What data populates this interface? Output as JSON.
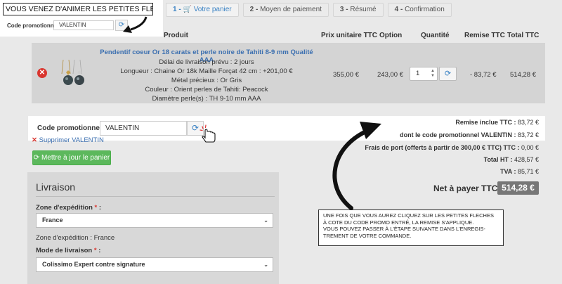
{
  "steps": [
    {
      "num": "1 - ",
      "label": "Votre panier",
      "icon": "cart-icon"
    },
    {
      "num": "2 - ",
      "label": "Moyen de paiement"
    },
    {
      "num": "3 - ",
      "label": "Résumé"
    },
    {
      "num": "4 - ",
      "label": "Confirmation"
    }
  ],
  "top_callout": {
    "note": "VOUS VENEZ D'ANIMER LES PETITES FLECHES",
    "promo_label": "Code promotionnel :",
    "promo_value": "VALENTIN"
  },
  "table": {
    "headers": {
      "product": "Produit",
      "unit_price": "Prix unitaire TTC",
      "option": "Option",
      "quantity": "Quantité",
      "discount": "Remise TTC",
      "total": "Total TTC"
    }
  },
  "product": {
    "title": "Pendentif coeur Or 18 carats et perle noire de Tahiti 8-9 mm Qualité AAA",
    "lines": [
      "Délai de livraison prévu : 2 jours",
      "Longueur : Chaine Or 18k Maille Forçat 42 cm : +201,00 €",
      "Métal précieux : Or Gris",
      "Couleur : Orient perles de Tahiti: Peacock",
      "Diamètre perle(s) : TH 9-10 mm AAA"
    ],
    "unit_price": "355,00 €",
    "option": "243,00 €",
    "quantity": "1",
    "discount": "- 83,72 €",
    "total": "514,28 €"
  },
  "promo": {
    "label": "Code promotionnel :",
    "value": "VALENTIN",
    "remove_label": "Supprimer VALENTIN",
    "update_label": "Mettre à jour le panier"
  },
  "shipping": {
    "title": "Livraison",
    "zone_label": "Zone d'expédition",
    "required_mark": "*",
    "label_suffix": " :",
    "zone_value": "France",
    "zone_text": "Zone d'expédition : France",
    "mode_label": "Mode de livraison",
    "mode_value": "Colissimo Expert contre signature"
  },
  "totals": {
    "discount_label": "Remise inclue TTC :",
    "discount_value": "83,72 €",
    "code_label": "dont le code promotionnel VALENTIN :",
    "code_value": "83,72 €",
    "shipping_label": "Frais de port (offerts à partir de 300,00 € TTC) TTC :",
    "shipping_value": "0,00 €",
    "ht_label": "Total HT :",
    "ht_value": "428,57 €",
    "tva_label": "TVA :",
    "tva_value": "85,71 €",
    "net_label": "Net à payer TTC :",
    "net_value": "514,28 €"
  },
  "bottom_callout": {
    "lines": [
      "Une fois que vous aurez cliquez sur les petites fleches",
      "à cote du code promo entré, la remise s'applique.",
      "Vous pouvez passer à l'étape suivante dans l'enregis-",
      "trement de votre commande."
    ]
  },
  "colors": {
    "link_blue": "#3b6fb0",
    "green_button": "#5cb85c",
    "remove_red": "#d9362f",
    "net_badge": "#777777"
  }
}
